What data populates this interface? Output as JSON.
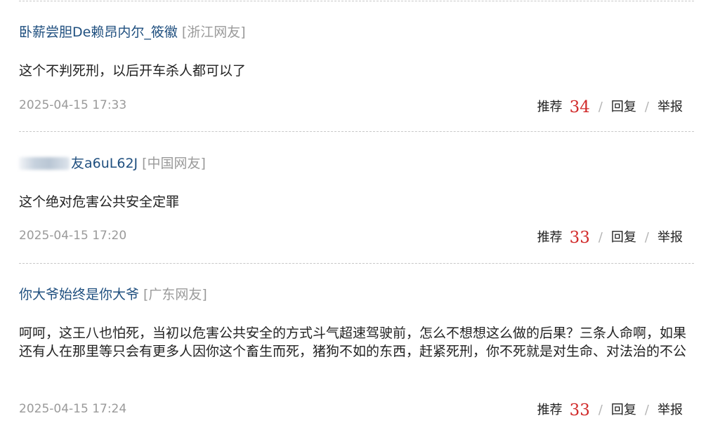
{
  "comments": [
    {
      "user": "卧薪尝胆De赖昂内尔_筱徽",
      "region": "[浙江网友]",
      "text": "这个不判死刑，以后开车杀人都可以了",
      "time": "2025-04-15 17:33",
      "recommend_label": "推荐",
      "recommend_count": "34",
      "reply_label": "回复",
      "report_label": "举报",
      "separator": "/"
    },
    {
      "user": "友a6uL62J",
      "region": "[中国网友]",
      "text": "这个绝对危害公共安全定罪",
      "time": "2025-04-15 17:20",
      "recommend_label": "推荐",
      "recommend_count": "33",
      "reply_label": "回复",
      "report_label": "举报",
      "separator": "/"
    },
    {
      "user": "你大爷始终是你大爷",
      "region": "[广东网友]",
      "text": "呵呵，这王八也怕死，当初以危害公共安全的方式斗气超速驾驶前，怎么不想想这么做的后果？三条人命啊，如果还有人在那里等只会有更多人因你这个畜生而死，猪狗不如的东西，赶紧死刑，你不死就是对生命、对法治的不公",
      "time": "2025-04-15 17:24",
      "recommend_label": "推荐",
      "recommend_count": "33",
      "reply_label": "回复",
      "report_label": "举报",
      "separator": "/"
    }
  ],
  "colors": {
    "username": "#1f4f7f",
    "region": "#9a9a9a",
    "count": "#d12a2a",
    "text": "#222222",
    "time": "#9a9a9a",
    "divider": "#c8c8c8"
  }
}
